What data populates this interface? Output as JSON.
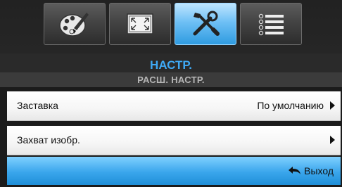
{
  "tabs": [
    {
      "icon": "palette-icon",
      "active": false
    },
    {
      "icon": "fullscreen-icon",
      "active": false
    },
    {
      "icon": "tools-icon",
      "active": true
    },
    {
      "icon": "list-icon",
      "active": false
    }
  ],
  "header": {
    "title": "НАСТР.",
    "subtitle": "РАСШ. НАСТР."
  },
  "menu": {
    "items": [
      {
        "label": "Заставка",
        "value": "По умолчанию"
      },
      {
        "label": "Захват изобр.",
        "value": ""
      }
    ]
  },
  "footer": {
    "exit_label": "Выход"
  },
  "colors": {
    "accent": "#3fa9f5",
    "active_tab": "#6fc0f5",
    "footer": "#3aa6ec"
  }
}
